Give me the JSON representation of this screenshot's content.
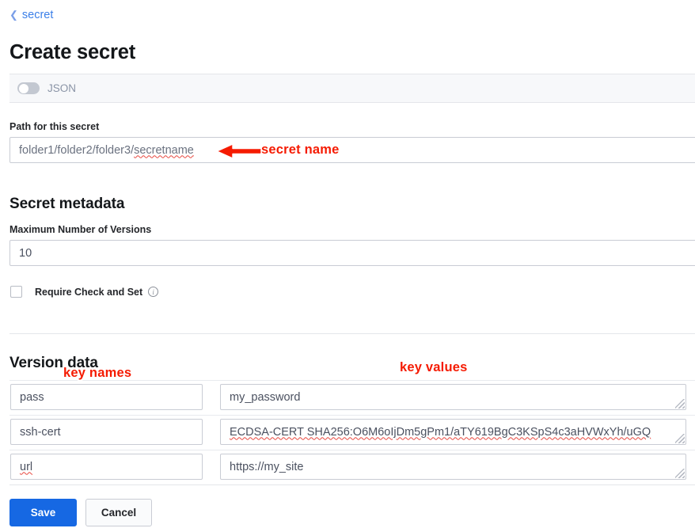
{
  "breadcrumb": {
    "icon": "chevron-left-icon",
    "label": "secret"
  },
  "page_title": "Create secret",
  "json_toggle": {
    "label": "JSON",
    "state": "off"
  },
  "path_section": {
    "label": "Path for this secret",
    "value": "folder1/folder2/folder3/secretname"
  },
  "metadata_section": {
    "heading": "Secret metadata",
    "max_versions_label": "Maximum Number of Versions",
    "max_versions_value": "10",
    "check_and_set_label": "Require Check and Set",
    "check_and_set_checked": false,
    "info_icon": "info-icon",
    "info_glyph": "i"
  },
  "version_data": {
    "heading": "Version data",
    "rows": [
      {
        "key": "pass",
        "value": "my_password"
      },
      {
        "key": "ssh-cert",
        "value": "ECDSA-CERT SHA256:O6M6oIjDm5gPm1/aTY619BgC3KSpS4c3aHVWxYh/uGQ"
      },
      {
        "key": "url",
        "value": "https://my_site"
      }
    ]
  },
  "footer": {
    "save_label": "Save",
    "cancel_label": "Cancel"
  },
  "annotations": {
    "secret_name": "secret name",
    "key_names": "key names",
    "key_values": "key values",
    "color": "#f51b02",
    "arrow": "left-arrow-annotation"
  },
  "colors": {
    "accent_blue": "#1668e3",
    "link_blue": "#3b7fe8",
    "strip_bg": "#f7f8fa",
    "border": "#c9ccd4"
  }
}
